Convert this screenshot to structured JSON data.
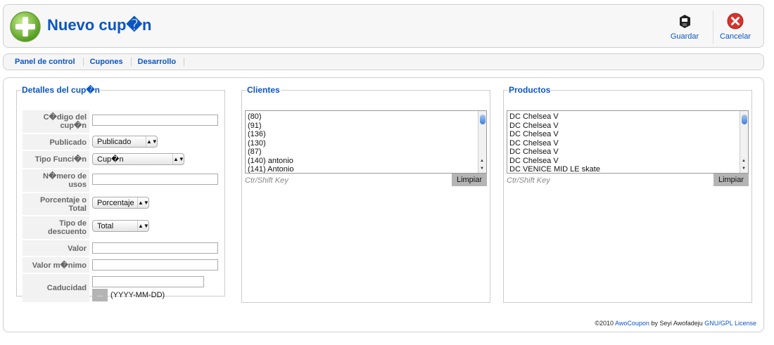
{
  "header": {
    "title": "Nuevo cup�n",
    "save_label": "Guardar",
    "cancel_label": "Cancelar",
    "logo_icon": "add-icon",
    "accent": "#0b55c4"
  },
  "submenu": [
    "Panel de control",
    "Cupones",
    "Desarrollo"
  ],
  "details": {
    "legend": "Detalles del cup�n",
    "fields": {
      "code_label": "C�digo del cup�n",
      "published_label": "Publicado",
      "published_value": "Publicado",
      "function_label": "Tipo Funci�n",
      "function_value": "Cup�n",
      "uses_label": "N�mero de usos",
      "percent_label": "Porcentaje o Total",
      "percent_value": "Porcentaje",
      "discount_label": "Tipo de descuento",
      "discount_value": "Total",
      "value_label": "Valor",
      "min_label": "Valor m�nimo",
      "expiry_label": "Caducidad",
      "date_button": "...",
      "date_format": "(YYYY-MM-DD)"
    }
  },
  "clients": {
    "legend": "Clientes",
    "items": [
      "(80)",
      "(91)",
      "(136)",
      "(130)",
      "(87)",
      "(140) antonio",
      "(141) Antonio"
    ],
    "hint": "Ctr/Shift Key",
    "clear_label": "Limpiar"
  },
  "products": {
    "legend": "Productos",
    "items": [
      "DC Chelsea V",
      "DC Chelsea V",
      "DC Chelsea V",
      "DC Chelsea V",
      "DC Chelsea V",
      "DC Chelsea V",
      "DC VENICE MID LE skate"
    ],
    "hint": "Ctr/Shift Key",
    "clear_label": "Limpiar"
  },
  "footer": {
    "prefix": "©2010 ",
    "product": "AwoCoupon",
    "by": " by Seyi Awofadeju ",
    "license": "GNU/GPL License"
  }
}
